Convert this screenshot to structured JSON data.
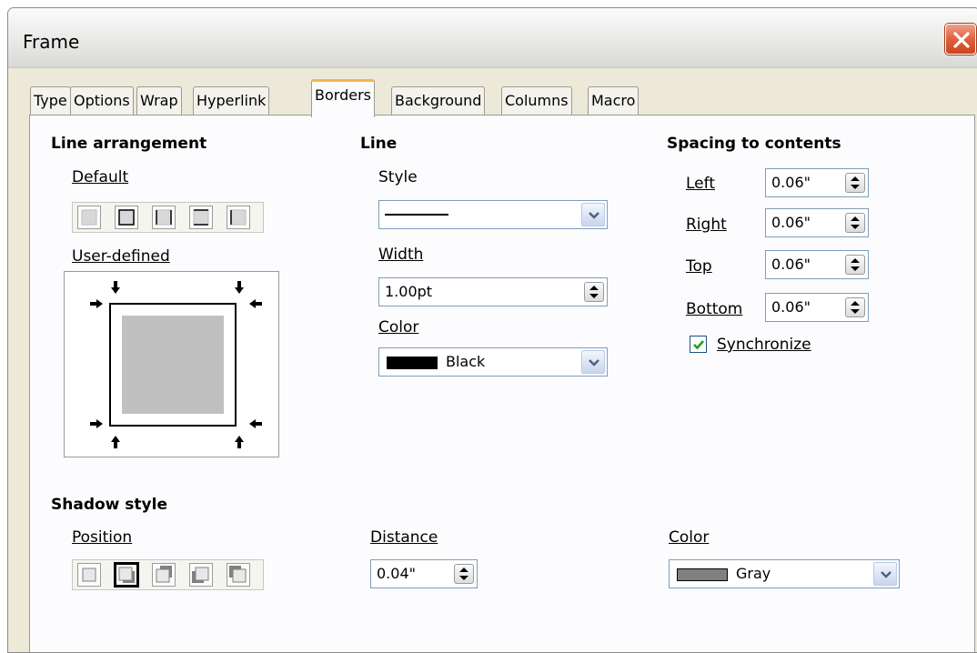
{
  "window": {
    "title": "Frame"
  },
  "tabs": [
    "Type",
    "Options",
    "Wrap",
    "Hyperlink",
    "Borders",
    "Background",
    "Columns",
    "Macro"
  ],
  "active_tab": "Borders",
  "line_arrangement": {
    "heading": "Line arrangement",
    "default_label": "Default",
    "user_defined_label": "User-defined"
  },
  "line": {
    "heading": "Line",
    "style_label": "Style",
    "width_label": "Width",
    "width_value": "1.00pt",
    "color_label": "Color",
    "color_value": "Black",
    "color_swatch": "#000000"
  },
  "spacing": {
    "heading": "Spacing to contents",
    "left_label": "Left",
    "left_value": "0.06\"",
    "right_label": "Right",
    "right_value": "0.06\"",
    "top_label": "Top",
    "top_value": "0.06\"",
    "bottom_label": "Bottom",
    "bottom_value": "0.06\"",
    "synchronize_label": "Synchronize",
    "synchronize_checked": true
  },
  "shadow": {
    "heading": "Shadow style",
    "position_label": "Position",
    "distance_label": "Distance",
    "distance_value": "0.04\"",
    "color_label": "Color",
    "color_value": "Gray",
    "color_swatch": "#808080"
  },
  "colors": {
    "active_tab_accent": "#f5b64a",
    "close_button": "#e0603c",
    "dialog_bg": "#ece9d8",
    "checkmark": "#21a121"
  }
}
